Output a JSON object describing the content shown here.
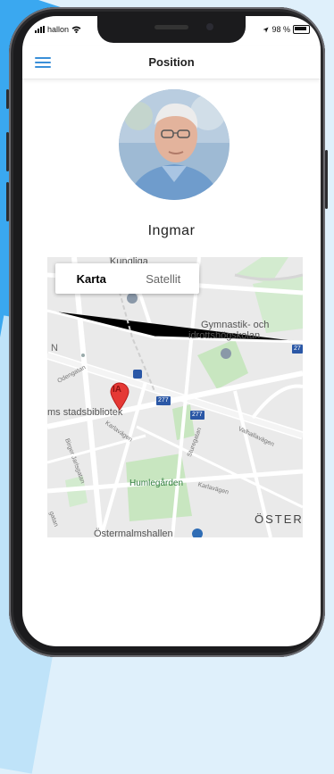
{
  "status": {
    "carrier": "hallon",
    "battery": "98 %"
  },
  "nav": {
    "title": "Position"
  },
  "profile": {
    "name": "Ingmar"
  },
  "map": {
    "tabs": [
      {
        "label": "Karta",
        "active": true
      },
      {
        "label": "Satellit",
        "active": false
      }
    ],
    "pin_label": "IA",
    "labels": {
      "kungliga": "Kungliga",
      "gymnastik_1": "Gymnastik- och",
      "gymnastik_2": "idrottshögskolan",
      "stadsbibliotek": "ms stadsbibliotek",
      "humlegarden": "Humlegården",
      "oster": "ÖSTER",
      "ostermalmshallen": "Östermalmshallen",
      "odengatan": "Odengatan",
      "karlavagen_1": "Karlavägen",
      "karlavagen_2": "Karlavägen",
      "valhallavagen": "Valhallavägen",
      "sturegatan": "Sturegatan",
      "birger_jarlsgatan": "Birger Jarlsgatan",
      "engelbrektsgatan": "gatan",
      "n": "N",
      "route_277_a": "277",
      "route_277_b": "277",
      "route_27": "27"
    }
  },
  "colors": {
    "accent": "#3a8fd8",
    "pin": "#e53935",
    "park": "#c8e6c0"
  }
}
